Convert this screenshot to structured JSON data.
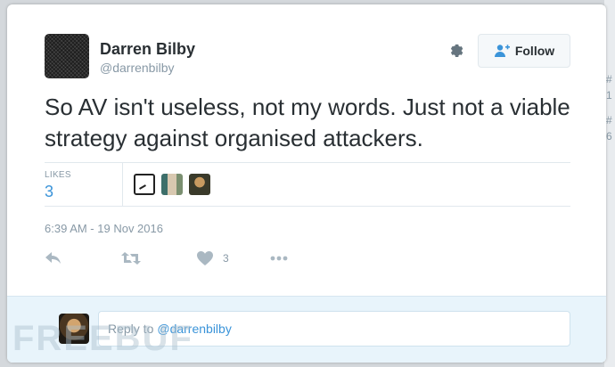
{
  "background_edge": {
    "line1": "#",
    "line2": "1",
    "line3": "#",
    "line4": "6"
  },
  "tweet": {
    "author_name": "Darren Bilby",
    "author_handle": "@darrenbilby",
    "follow_label": "Follow",
    "text": "So AV isn't useless, not my words. Just not a viable strategy against organised attackers.",
    "likes_label": "LIKES",
    "likes_count": "3",
    "timestamp": "6:39 AM - 19 Nov 2016",
    "action_like_count": "3"
  },
  "reply": {
    "prefix": "Reply to",
    "mention": "@darrenbilby"
  },
  "watermark": {
    "text": "FREEBUF"
  },
  "icons": {
    "gear": "gear-icon",
    "follow": "user-plus-icon",
    "reply": "reply-icon",
    "retweet": "retweet-icon",
    "like": "heart-icon",
    "more": "more-dots-icon"
  },
  "colors": {
    "link_blue": "#3b94d9",
    "text_dark": "#292f33",
    "text_muted": "#8899a6",
    "reply_bg": "#e8f4fb"
  }
}
